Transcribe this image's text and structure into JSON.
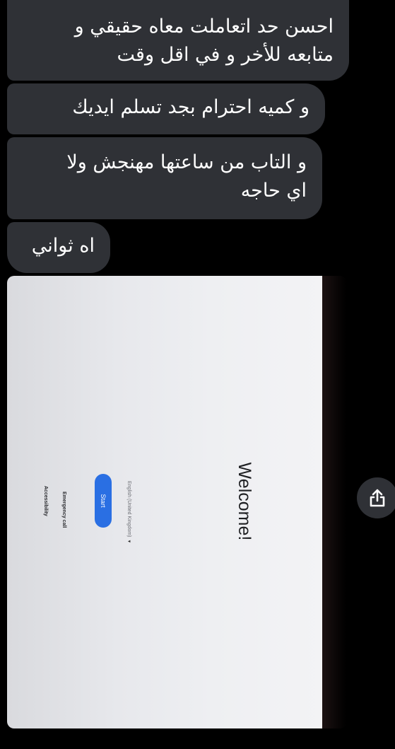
{
  "messages": [
    {
      "lines": [
        "احسن حد اتعاملت معاه حقيقي و",
        "متابعه للأخر و في اقل وقت"
      ]
    },
    {
      "lines": [
        "و كميه احترام بجد تسلم ايديك"
      ]
    },
    {
      "lines": [
        "و التاب من ساعتها مهنجش ولا",
        "اي حاجه"
      ]
    },
    {
      "lines": [
        "اه ثواني"
      ]
    }
  ],
  "photo": {
    "welcome_title": "Welcome!",
    "start_button": "Start",
    "language": "English (United Kingdom)",
    "emergency_call": "Emergency call",
    "accessibility": "Accessibility"
  },
  "colors": {
    "bubble_bg": "#2f3136",
    "start_button_bg": "#2a6fe3"
  },
  "icons": {
    "share": "share-icon"
  }
}
